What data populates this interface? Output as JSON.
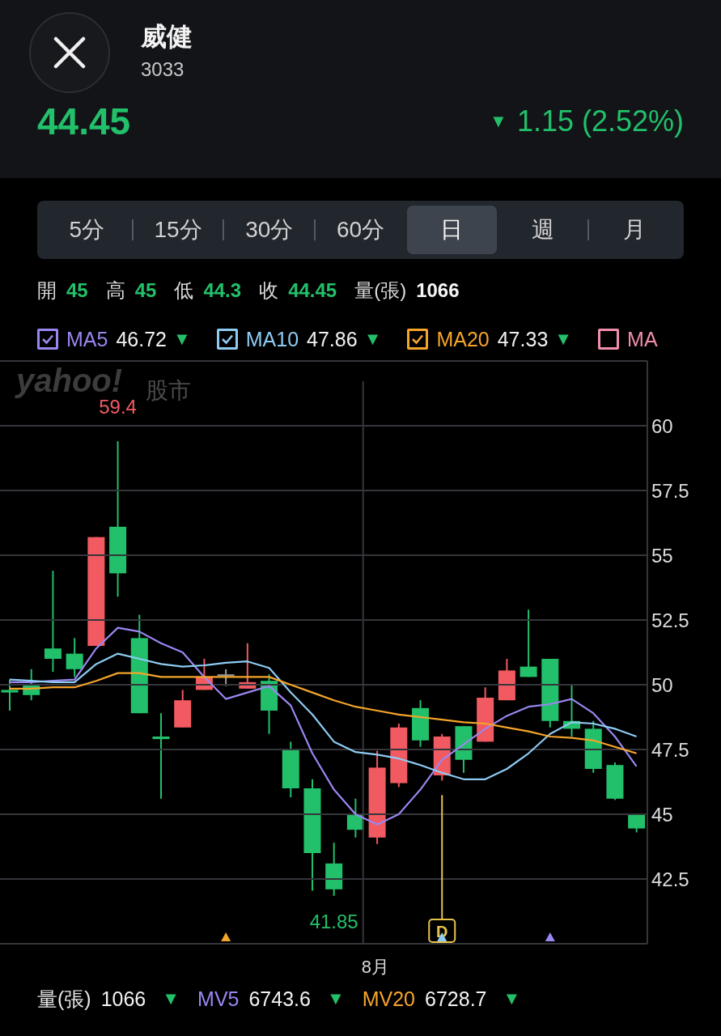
{
  "header": {
    "name": "威健",
    "code": "3033",
    "price": "44.45",
    "change_arrow": "▼",
    "change": "1.15 (2.52%)"
  },
  "tabs": [
    {
      "label": "5分",
      "selected": false
    },
    {
      "label": "15分",
      "selected": false
    },
    {
      "label": "30分",
      "selected": false
    },
    {
      "label": "60分",
      "selected": false
    },
    {
      "label": "日",
      "selected": true
    },
    {
      "label": "週",
      "selected": false
    },
    {
      "label": "月",
      "selected": false
    }
  ],
  "ohlc": [
    {
      "label": "開",
      "value": "45",
      "kind": "price"
    },
    {
      "label": "高",
      "value": "45",
      "kind": "price"
    },
    {
      "label": "低",
      "value": "44.3",
      "kind": "price"
    },
    {
      "label": "收",
      "value": "44.45",
      "kind": "price"
    },
    {
      "label": "量(張)",
      "value": "1066",
      "kind": "volume"
    }
  ],
  "ma_legend": [
    {
      "value": "46.72",
      "arrow": "▼",
      "checked": true,
      "color": "#9b86f0"
    },
    {
      "value": "47.86",
      "arrow": "▼",
      "checked": true,
      "color": "#8ecbf2"
    },
    {
      "value": "47.33",
      "arrow": "▼",
      "checked": true,
      "color": "#f5a52a"
    },
    {
      "name": "MA",
      "checked": false,
      "color": "#f08fab"
    }
  ],
  "chart": {
    "watermark": {
      "logo": "yahoo!",
      "text": "股市"
    },
    "month_label": "8月",
    "chart_data": {
      "type": "line",
      "ylim": [
        40,
        62.5
      ],
      "yticks": [
        42.5,
        45,
        47.5,
        50,
        52.5,
        55,
        57.5,
        60
      ],
      "grid": true,
      "series": [
        {
          "name": "MA5",
          "color": "#9b86f0",
          "values": [
            50.1,
            50.1,
            50.15,
            50.2,
            51.4,
            52.2,
            52.05,
            51.6,
            51.25,
            50.3,
            49.45,
            49.7,
            49.95,
            49.2,
            47.35,
            45.95,
            45.0,
            44.6,
            45.0,
            45.95,
            47.1,
            47.7,
            48.3,
            48.8,
            49.15,
            49.25,
            49.45,
            48.9,
            48.0,
            46.85
          ]
        },
        {
          "name": "MA10",
          "color": "#8ecbf2",
          "values": [
            50.2,
            50.15,
            50.1,
            50.1,
            50.8,
            51.2,
            51.0,
            50.8,
            50.7,
            50.75,
            50.85,
            50.9,
            50.65,
            49.7,
            48.85,
            47.8,
            47.4,
            47.3,
            47.15,
            46.9,
            46.6,
            46.35,
            46.35,
            46.75,
            47.35,
            48.1,
            48.55,
            48.5,
            48.3,
            48.0
          ]
        },
        {
          "name": "MA20",
          "color": "#f5a52a",
          "values": [
            49.85,
            49.85,
            49.9,
            49.9,
            50.15,
            50.45,
            50.45,
            50.3,
            50.3,
            50.3,
            50.3,
            50.3,
            50.3,
            50.0,
            49.7,
            49.4,
            49.15,
            49.0,
            48.85,
            48.75,
            48.65,
            48.55,
            48.5,
            48.35,
            48.2,
            48.0,
            47.95,
            47.85,
            47.6,
            47.35
          ]
        }
      ],
      "annotations": [
        {
          "text": "59.4"
        },
        {
          "text": "41.85"
        },
        {
          "text": "D"
        }
      ]
    },
    "signals": [
      {
        "color": "#f5a52a"
      },
      {
        "color": "#8ecbf2"
      },
      {
        "color": "#9b86f0"
      }
    ]
  },
  "volume_row": [
    {
      "label": "量(張)",
      "value": "1066",
      "arrow": "▼",
      "color": "#e6e6e6"
    },
    {
      "label": "MV5",
      "value": "6743.6",
      "arrow": "▼",
      "color": "#9b86f0"
    },
    {
      "label": "MV20",
      "value": "6728.7",
      "arrow": "▼",
      "color": "#f5a52a"
    }
  ]
}
